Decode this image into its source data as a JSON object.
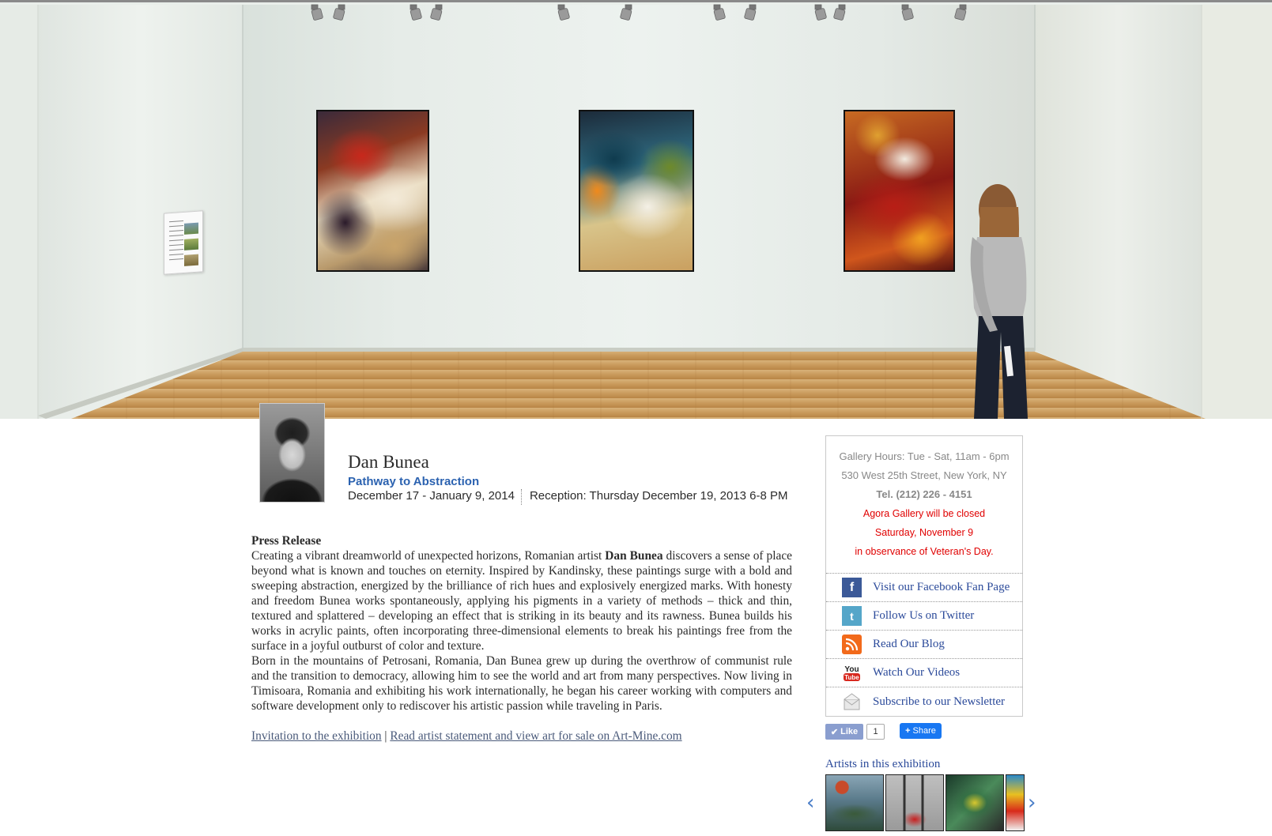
{
  "artist": {
    "name": "Dan Bunea",
    "exhibition_title": "Pathway to Abstraction",
    "dates": "December 17 - January 9, 2014",
    "reception": "Reception: Thursday December 19, 2013 6-8 PM"
  },
  "press_release": {
    "heading": "Press Release",
    "p1_a": "Creating a vibrant dreamworld of unexpected horizons, Romanian artist ",
    "p1_bold": "Dan Bunea",
    "p1_b": " discovers a sense of place beyond what is known and touches on eternity. Inspired by Kandinsky, these paintings surge with a bold and sweeping abstraction, energized by the brilliance of rich hues and explosively energized marks. With honesty and freedom Bunea works spontaneously, applying his pigments in a variety of methods – thick and thin, textured and splattered – developing an effect that is striking in its beauty and its rawness. Bunea builds his works in acrylic paints, often incorporating three-dimensional elements to break his paintings free from the surface in a joyful outburst of color and texture.",
    "p2": "Born in the mountains of Petrosani, Romania, Dan Bunea grew up during the overthrow of communist rule and the transition to democracy, allowing him to see the world and art from many perspectives. Now living in Timisoara, Romania and exhibiting his work internationally, he began his career working with computers and software development only to rediscover his artistic passion while traveling in Paris.",
    "link_invitation": "Invitation to the exhibition",
    "link_separator": " | ",
    "link_artmine": "Read artist statement and view art for sale on Art-Mine.com"
  },
  "gallery_info": {
    "hours": "Gallery Hours: Tue - Sat, 11am - 6pm",
    "address": "530 West 25th Street, New York, NY",
    "phone": "Tel. (212) 226 - 4151",
    "notice_1": "Agora Gallery will be closed",
    "notice_2": "Saturday, November 9",
    "notice_3": "in observance of Veteran's Day."
  },
  "social_links": [
    {
      "label": "Visit our Facebook Fan Page",
      "icon": "facebook-icon"
    },
    {
      "label": "Follow Us on Twitter",
      "icon": "twitter-icon"
    },
    {
      "label": "Read Our Blog",
      "icon": "rss-icon"
    },
    {
      "label": "Watch Our Videos",
      "icon": "youtube-icon"
    },
    {
      "label": "Subscribe to our Newsletter",
      "icon": "newsletter-icon"
    }
  ],
  "social_buttons": {
    "like_label": "Like",
    "like_count": "1",
    "share_label": "Share"
  },
  "artists_strip": {
    "heading": "Artists in this exhibition"
  },
  "colors": {
    "link_blue": "#2b4a9a",
    "title_blue": "#2b62b0",
    "notice_red": "#e00000"
  }
}
